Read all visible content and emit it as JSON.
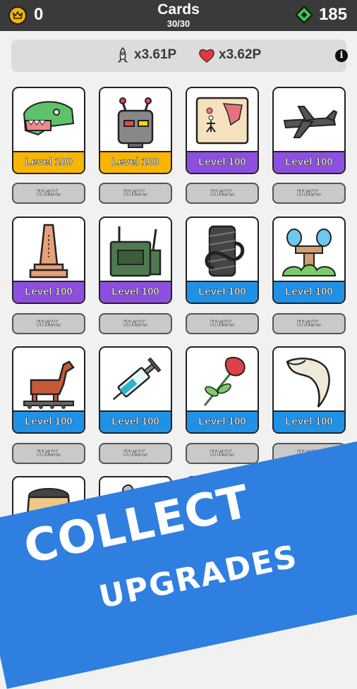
{
  "header": {
    "coins": "0",
    "title": "Cards",
    "subtitle": "30/30",
    "gems": "185"
  },
  "stats": {
    "rocket_multiplier": "x3.61P",
    "heart_multiplier": "x3.62P",
    "info": "i"
  },
  "colors": {
    "gold": "#f7b500",
    "purple": "#8e4fe0",
    "blue": "#1f92e8",
    "banner": "#2f7fe0"
  },
  "cards": [
    {
      "icon": "dinosaur-head",
      "level": "Level 100",
      "tier": "gold",
      "button": "max."
    },
    {
      "icon": "robot-head",
      "level": "Level 100",
      "tier": "gold",
      "button": "max."
    },
    {
      "icon": "treasure-map",
      "level": "Level 100",
      "tier": "purple",
      "button": "max."
    },
    {
      "icon": "drone",
      "level": "Level 100",
      "tier": "purple",
      "button": "max."
    },
    {
      "icon": "obelisk",
      "level": "Level 100",
      "tier": "purple",
      "button": "max."
    },
    {
      "icon": "radio-transmitter",
      "level": "Level 100",
      "tier": "purple",
      "button": "max."
    },
    {
      "icon": "rope-spool",
      "level": "Level 100",
      "tier": "blue",
      "button": "max."
    },
    {
      "icon": "fountain",
      "level": "Level 100",
      "tier": "blue",
      "button": "max."
    },
    {
      "icon": "trojan-horse",
      "level": "Level 100",
      "tier": "blue",
      "button": "max."
    },
    {
      "icon": "syringe",
      "level": "Level 100",
      "tier": "blue",
      "button": "max."
    },
    {
      "icon": "rose",
      "level": "Level 100",
      "tier": "blue",
      "button": "max."
    },
    {
      "icon": "claw",
      "level": "Level 100",
      "tier": "blue",
      "button": "max."
    },
    {
      "icon": "gunpowder-sack",
      "tier": "partial"
    },
    {
      "icon": "mortar-pestle",
      "tier": "partial"
    },
    {
      "icon": "scroll",
      "tier": "partial"
    },
    {
      "icon": "frog",
      "tier": "partial"
    }
  ],
  "banner": {
    "line1": "COLLECT",
    "line2": "UPGRADES"
  }
}
